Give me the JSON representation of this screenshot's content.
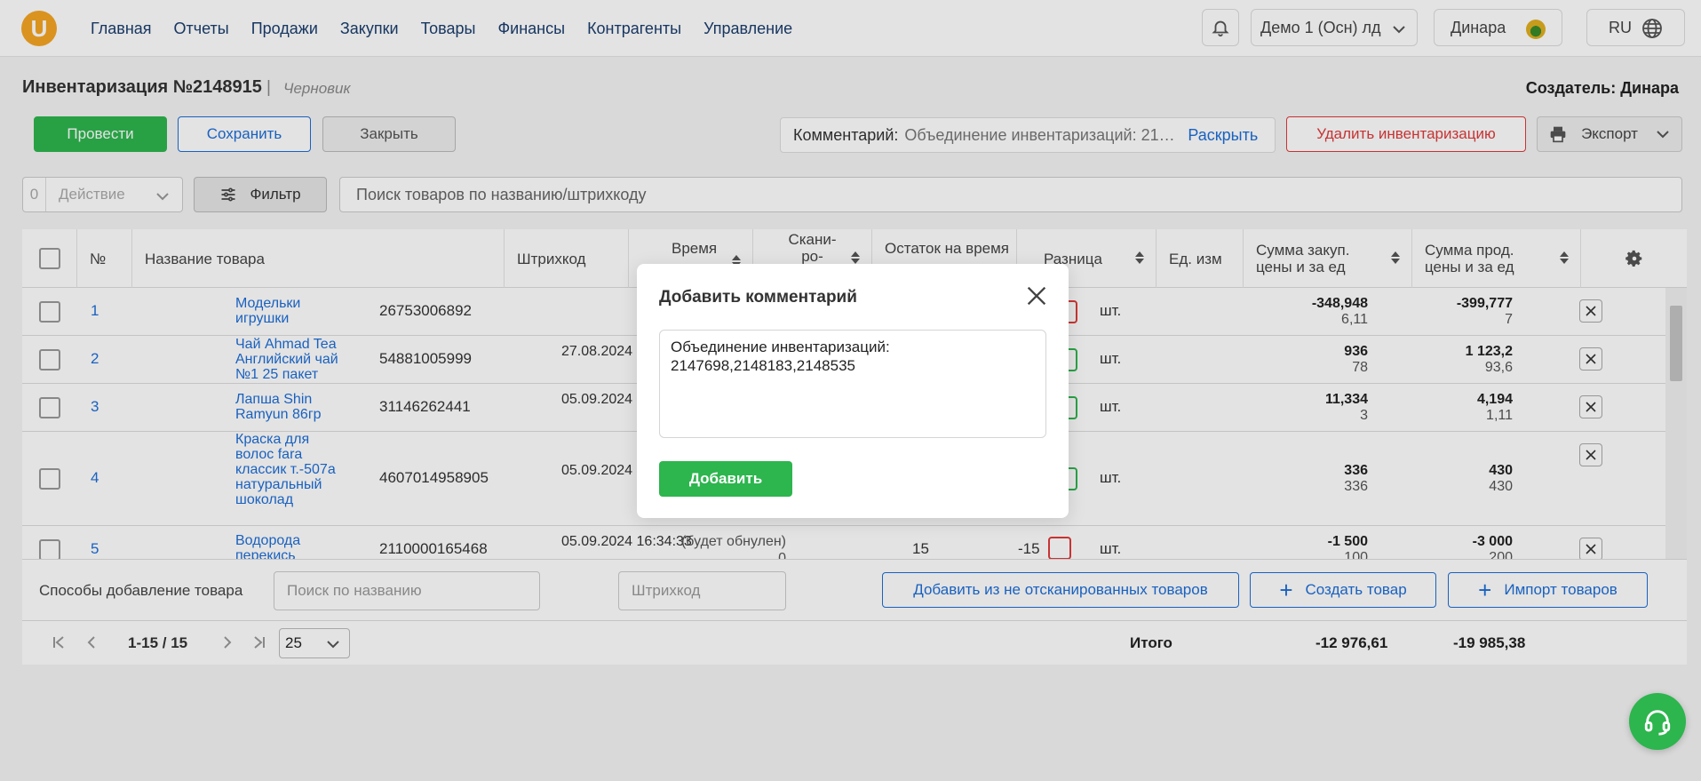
{
  "nav": {
    "logo": "U",
    "menu": [
      "Главная",
      "Отчеты",
      "Продажи",
      "Закупки",
      "Товары",
      "Финансы",
      "Контрагенты",
      "Управление"
    ],
    "org": "Демо 1 (Осн) лд",
    "user": "Динара",
    "lang": "RU"
  },
  "header": {
    "title": "Инвентаризация №2148915",
    "separator": "|",
    "status": "Черновик",
    "creator": "Создатель: Динара"
  },
  "actions": {
    "conduct": "Провести",
    "save": "Сохранить",
    "close": "Закрыть",
    "comment_label": "Комментарий:",
    "comment_value": "Объединение инвентаризаций: 2147698,2148183,2148535",
    "expand": "Раскрыть",
    "delete": "Удалить инвентаризацию",
    "export": "Экспорт"
  },
  "toolbar": {
    "selected_count": "0",
    "action": "Действие",
    "filter": "Фильтр",
    "search_placeholder": "Поиск товаров по названию/штрихкоду"
  },
  "table": {
    "headers": {
      "no": "№",
      "name": "Название товара",
      "barcode": "Штрихкод",
      "time": "Время",
      "scanned": "Скани-ро-",
      "stock": "Остаток на время",
      "diff": "Разница",
      "unit": "Ед. изм",
      "purchase": "Сумма закуп. цены и за ед",
      "sale": "Сумма прод. цены и за ед"
    },
    "rows": [
      {
        "no": "1",
        "name": "Модельки игрушки",
        "barcode": "26753006892",
        "time": "",
        "unit": "шт.",
        "purchase_total": "-348,948",
        "purchase_unit": "6,11",
        "sale_total": "-399,777",
        "sale_unit": "7"
      },
      {
        "no": "2",
        "name": "Чай Ahmad Tea Английский чай №1 25 пакет",
        "barcode": "54881005999",
        "time": "27.08.2024 15:31:24",
        "unit": "шт.",
        "purchase_total": "936",
        "purchase_unit": "78",
        "sale_total": "1 123,2",
        "sale_unit": "93,6"
      },
      {
        "no": "3",
        "name": "Лапша Shin Ramyun 86гр",
        "barcode": "31146262441",
        "time": "05.09.2024 17:15:09",
        "unit": "шт.",
        "purchase_total": "11,334",
        "purchase_unit": "3",
        "sale_total": "4,194",
        "sale_unit": "1,11"
      },
      {
        "no": "4",
        "name": "Краска для волос fara классик т.-507а натуральный шоколад",
        "barcode": "4607014958905",
        "time": "05.09.2024 16:33:03",
        "unit": "шт.",
        "purchase_total": "336",
        "purchase_unit": "336",
        "sale_total": "430",
        "sale_unit": "430"
      },
      {
        "no": "5",
        "name": "Водорода перекись",
        "barcode": "2110000165468",
        "time": "05.09.2024 16:34:33",
        "scanned": "(будет обнулен) 0",
        "stock": "15",
        "diff": "-15",
        "unit": "шт.",
        "purchase_total": "-1 500",
        "purchase_unit": "100",
        "sale_total": "-3 000",
        "sale_unit": "200"
      }
    ]
  },
  "add_bar": {
    "label": "Способы добавление товара",
    "name_placeholder": "Поиск по названию",
    "barcode_placeholder": "Штрихкод",
    "from_unscanned": "Добавить из не отсканированных товаров",
    "create": "Создать товар",
    "import": "Импорт товаров"
  },
  "pager": {
    "range": "1-15 / 15",
    "page_size": "25",
    "total_label": "Итого",
    "total_purchase": "-12 976,61",
    "total_sale": "-19 985,38"
  },
  "modal": {
    "title": "Добавить комментарий",
    "text": "Объединение инвентаризаций:\n2147698,2148183,2148535",
    "submit": "Добавить"
  },
  "colors": {
    "brand": "#f5a623",
    "primary_green": "#2db54e",
    "link_blue": "#1d6ed8",
    "danger_red": "#e03a3a"
  }
}
